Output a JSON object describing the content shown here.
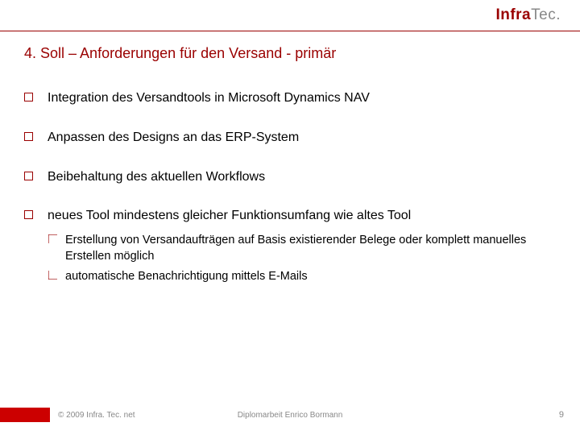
{
  "logo": {
    "part1": "Infra",
    "part2": "Tec."
  },
  "title": "4. Soll – Anforderungen für den Versand - primär",
  "bullets": [
    "Integration des Versandtools in Microsoft Dynamics NAV",
    "Anpassen des Designs an das ERP-System",
    "Beibehaltung des aktuellen Workflows",
    "neues Tool mindestens gleicher Funktionsumfang wie altes Tool"
  ],
  "subbullets": [
    "Erstellung von Versandaufträgen auf Basis existierender Belege oder komplett manuelles Erstellen möglich",
    "automatische Benachrichtigung mittels E-Mails"
  ],
  "footer": {
    "copyright": "© 2009 Infra. Tec. net",
    "center": "Diplomarbeit Enrico Bormann",
    "page": "9"
  }
}
